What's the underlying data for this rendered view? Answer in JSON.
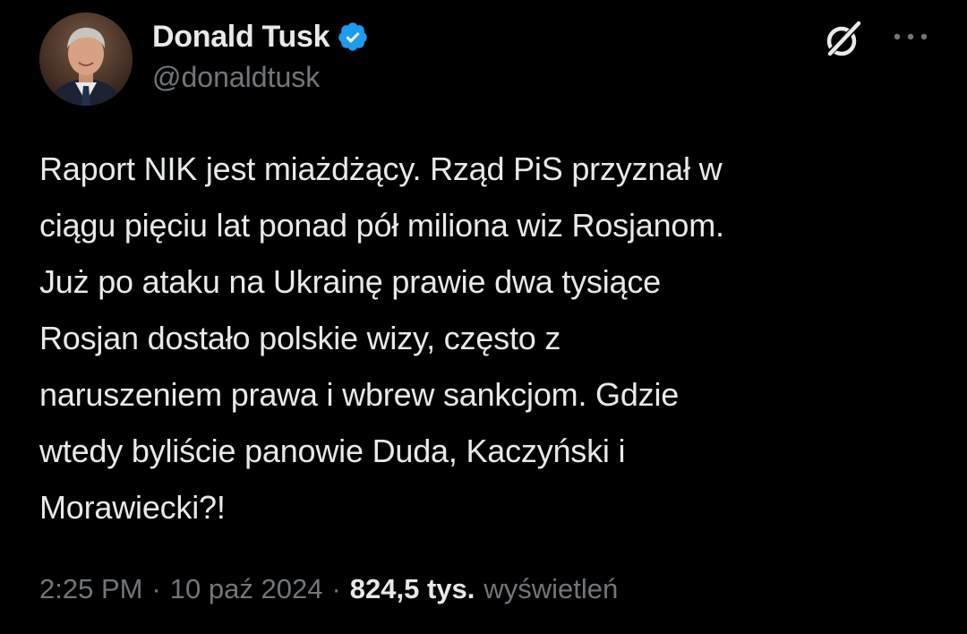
{
  "author": {
    "display_name": "Donald Tusk",
    "handle": "@donaldtusk",
    "verified": true,
    "avatar_icon": "profile-photo",
    "verified_icon": "verified-badge-icon"
  },
  "header_actions": {
    "grok_icon": "grok-icon",
    "more_icon": "more-options-icon"
  },
  "tweet": {
    "text": "Raport NIK jest miażdżący. Rząd PiS przyznał w\nciągu pięciu lat ponad pół miliona wiz Rosjanom.\nJuż po ataku na Ukrainę prawie dwa tysiące\nRosjan dostało polskie wizy, często z\nnaruszeniem prawa i wbrew sankcjom. Gdzie\nwtedy byliście panowie Duda, Kaczyński i\nMorawiecki?!"
  },
  "meta": {
    "time": "2:25 PM",
    "separator": "·",
    "date": "10 paź 2024",
    "views_count": "824,5 tys.",
    "views_label": "wyświetleń"
  },
  "colors": {
    "background": "#000000",
    "text_primary": "#e7e9ea",
    "text_secondary": "#71767b",
    "verified_blue": "#1d9bf0"
  }
}
